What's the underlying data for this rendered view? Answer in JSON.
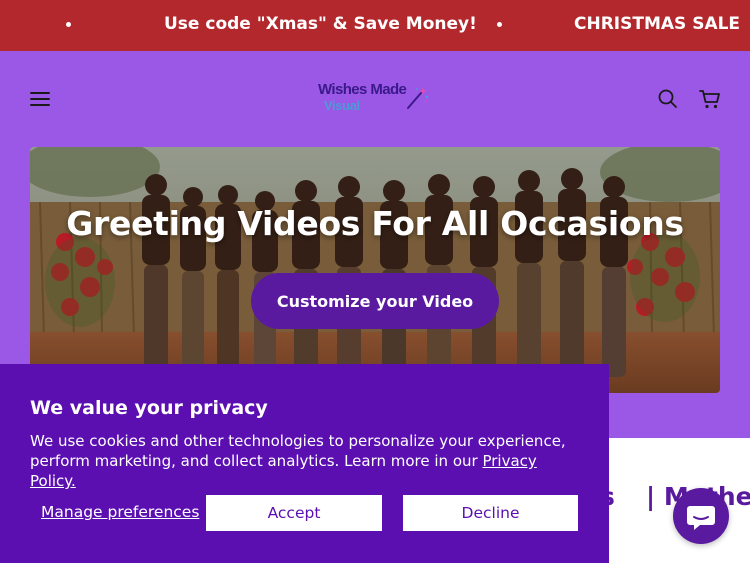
{
  "announcement": {
    "messages": [
      "Use code \"Xmas\" & Save Money!",
      "CHRISTMAS SALE"
    ],
    "background": "#b3282d"
  },
  "header": {
    "background": "#9b57e6",
    "logo": {
      "line1": "Wishes Made",
      "line2": "Visual"
    },
    "icons": [
      "menu-icon",
      "search-icon",
      "cart-icon"
    ]
  },
  "hero": {
    "title": "Greeting Videos For All Occasions",
    "cta_label": "Customize your Video"
  },
  "below": {
    "fragment_left": "s",
    "fragment_right": "| Mother"
  },
  "cookie_banner": {
    "title": "We value your privacy",
    "body": "We use cookies and other technologies to personalize your experience, perform marketing, and collect analytics. Learn more in our ",
    "policy_link": "Privacy Policy.",
    "manage_label": "Manage preferences",
    "accept_label": "Accept",
    "decline_label": "Decline",
    "background": "#5b0fb0"
  },
  "chat": {
    "icon": "chat-bubble-icon",
    "color": "#5a1aa0"
  }
}
